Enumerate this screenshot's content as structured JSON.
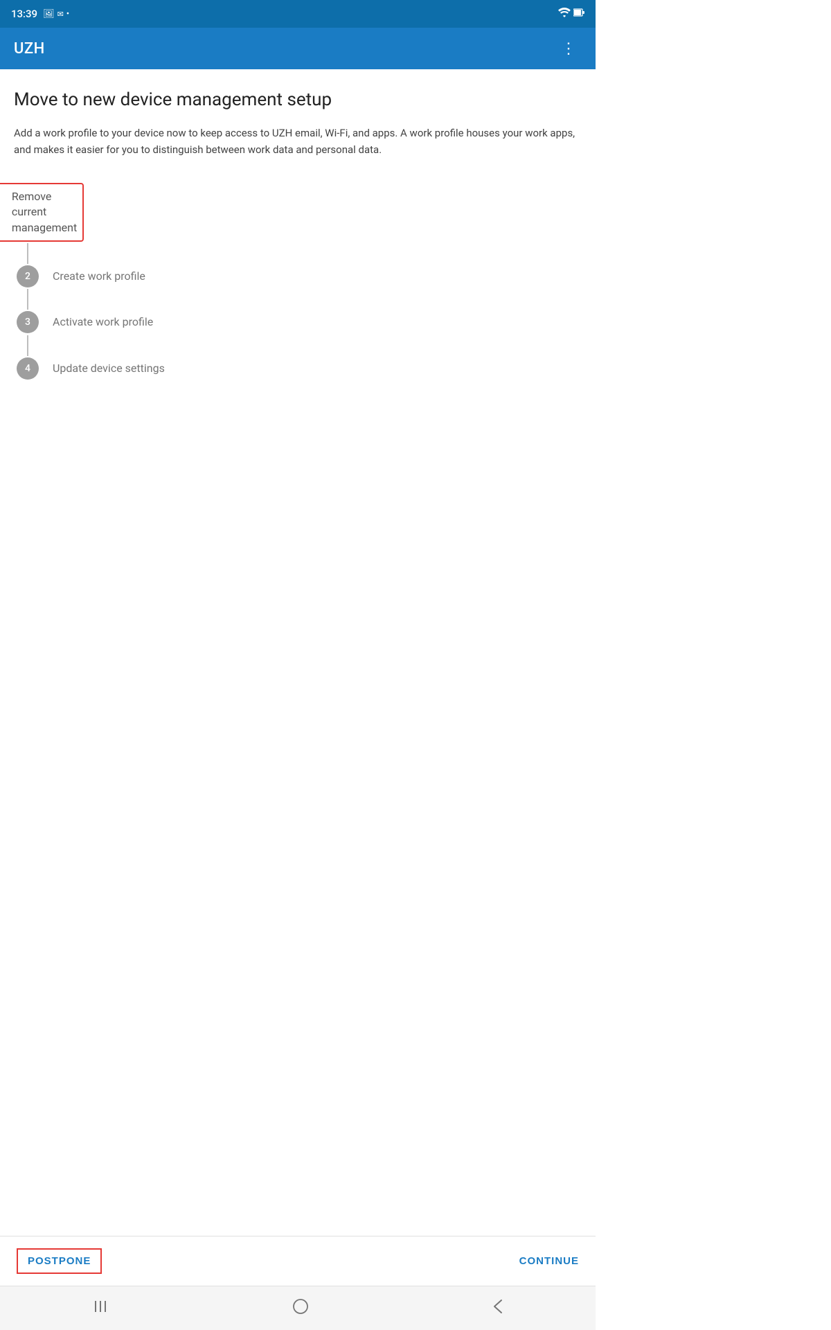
{
  "status_bar": {
    "time": "13:39"
  },
  "app_bar": {
    "title": "UZH",
    "menu_icon": "⋮"
  },
  "page": {
    "title": "Move to new device management setup",
    "description": "Add a work profile to your device now to keep access to UZH email, Wi-Fi, and apps. A work profile houses your work apps, and makes it easier for you to distinguish between work data and personal data."
  },
  "steps": [
    {
      "number": "✓",
      "label": "Remove current management",
      "state": "completed"
    },
    {
      "number": "2",
      "label": "Create work profile",
      "state": "pending"
    },
    {
      "number": "3",
      "label": "Activate work profile",
      "state": "pending"
    },
    {
      "number": "4",
      "label": "Update device settings",
      "state": "pending"
    }
  ],
  "actions": {
    "postpone_label": "POSTPONE",
    "continue_label": "CONTINUE"
  },
  "nav": {
    "menu_icon": "|||",
    "home_icon": "○",
    "back_icon": "<"
  }
}
